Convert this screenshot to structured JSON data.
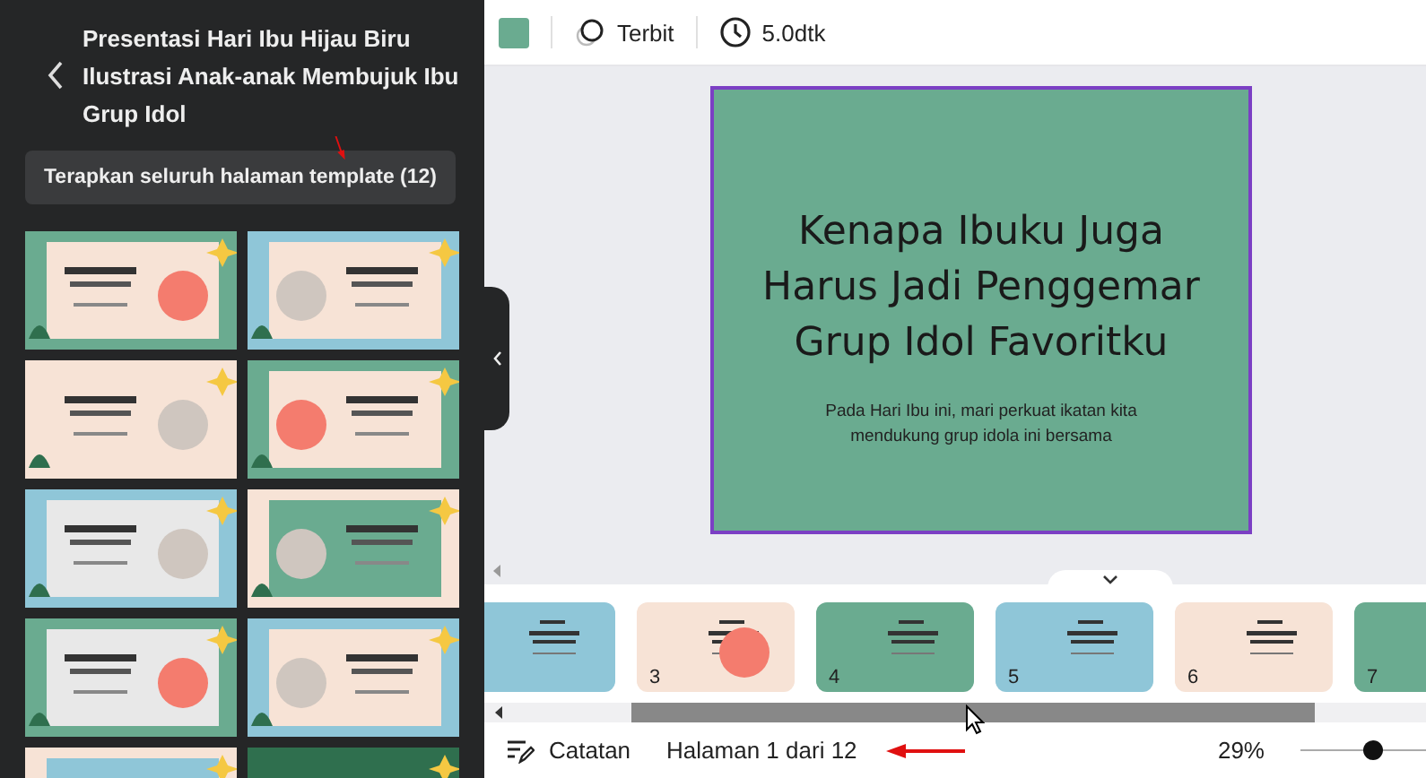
{
  "panel": {
    "title_lines": [
      "Presentasi Hari Ibu Hijau Biru",
      "Ilustrasi Anak-anak Membujuk Ibu",
      "Grup Idol"
    ],
    "apply_button": "Terapkan seluruh halaman template (12)",
    "templates": [
      {
        "kind": "picture"
      },
      {
        "kind": "picture"
      },
      {
        "kind": "picture"
      },
      {
        "kind": "picture"
      },
      {
        "kind": "picture"
      },
      {
        "kind": "picture"
      },
      {
        "kind": "picture"
      },
      {
        "kind": "picture"
      },
      {
        "kind": "picture"
      },
      {
        "kind": "picture"
      }
    ]
  },
  "toolbar": {
    "publish": "Terbit",
    "duration": "5.0dtk"
  },
  "slide": {
    "title_lines": [
      "Kenapa Ibuku Juga",
      "Harus Jadi Penggemar",
      "Grup Idol Favoritku"
    ],
    "subtitle_lines": [
      "Pada Hari Ibu ini, mari perkuat ikatan kita",
      "mendukung grup idola ini bersama"
    ]
  },
  "filmstrip": [
    {
      "kind": "picture"
    },
    {
      "kind": "picture",
      "number": "3"
    },
    {
      "kind": "picture",
      "number": "4"
    },
    {
      "kind": "picture",
      "number": "5"
    },
    {
      "kind": "picture",
      "number": "6"
    },
    {
      "kind": "picture",
      "number": "7"
    }
  ],
  "footer": {
    "notes": "Catatan",
    "page": "Halaman 1 dari 12",
    "zoom": "29%",
    "zoom_slider": {
      "level": 0.57
    }
  }
}
